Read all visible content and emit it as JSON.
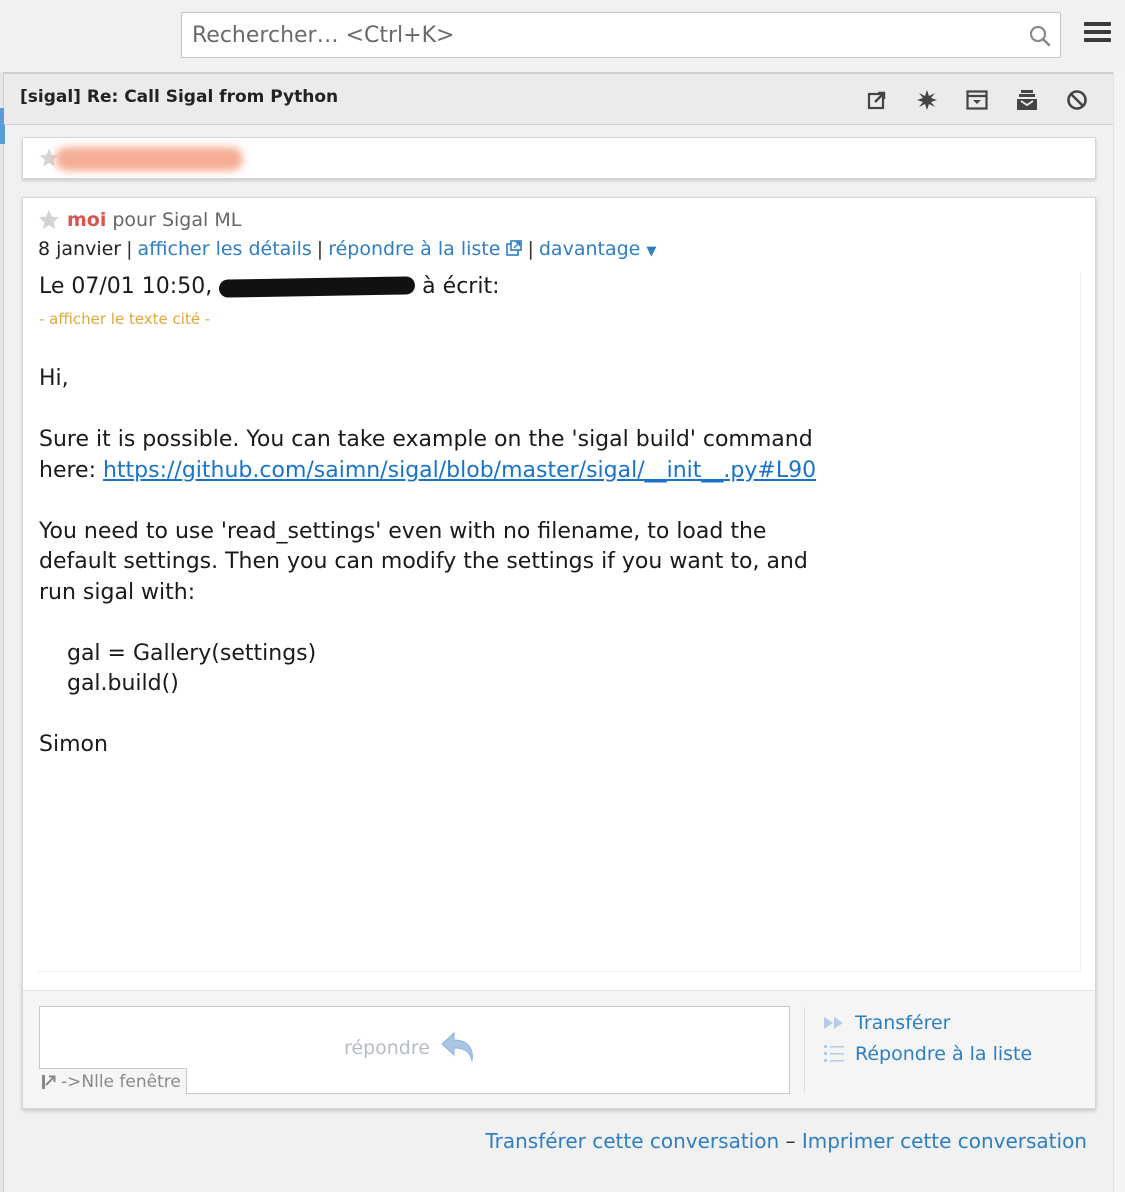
{
  "search": {
    "placeholder": "Rechercher… <Ctrl+K>"
  },
  "conversation": {
    "subject": "[sigal] Re: Call Sigal from Python",
    "toolbar_icons": [
      "open-in-new-icon",
      "burst-icon",
      "archive-icon",
      "inbox-stack-icon",
      "block-icon"
    ]
  },
  "message": {
    "sender": "moi",
    "recipient_text": "pour Sigal ML",
    "date": "8 janvier",
    "links": {
      "details": "afficher les détails",
      "reply_list": "répondre à la liste",
      "more": "davantage"
    },
    "quote_header_prefix": "Le 07/01 10:50, ",
    "quote_header_suffix": " à écrit:",
    "show_quoted": "- afficher le texte cité -",
    "body": {
      "greeting": "Hi,",
      "p1_line1": "Sure it is possible. You can take example on the 'sigal build' command",
      "p1_line2_prefix": "here: ",
      "p1_link": "https://github.com/saimn/sigal/blob/master/sigal/__init__.py#L90",
      "p2_line1": "You need to use 'read_settings' even with no filename, to load the",
      "p2_line2": "default settings. Then you can modify the settings if you want to, and",
      "p2_line3": "run sigal with:",
      "code1": "    gal = Gallery(settings)",
      "code2": "    gal.build()",
      "signature": "Simon"
    }
  },
  "reply": {
    "label": "répondre",
    "new_window": "->Nlle fenêtre",
    "forward": "Transférer",
    "reply_list": "Répondre à la liste"
  },
  "footer": {
    "forward_conversation": "Transférer cette conversation",
    "separator": "–",
    "print_conversation": "Imprimer cette conversation"
  }
}
